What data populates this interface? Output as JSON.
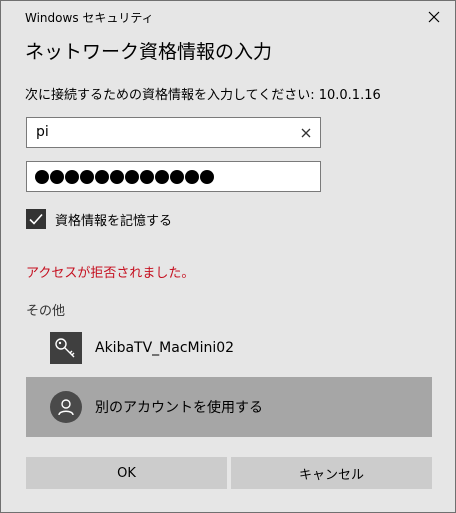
{
  "window": {
    "title": "Windows セキュリティ",
    "close_icon": "close-icon"
  },
  "dialog": {
    "heading": "ネットワーク資格情報の入力",
    "prompt": "次に接続するための資格情報を入力してください: 10.0.1.16"
  },
  "username": {
    "value": "pi",
    "clear_icon": "clear-icon"
  },
  "password": {
    "masked_length": 12
  },
  "remember": {
    "label": "資格情報を記憶する",
    "checked": true
  },
  "error": {
    "message": "アクセスが拒否されました。",
    "color": "#c50f1f"
  },
  "other": {
    "section_label": "その他",
    "saved_account": {
      "label": "AkibaTV_MacMini02",
      "icon": "key-icon"
    },
    "use_other_account": {
      "label": "別のアカウントを使用する",
      "icon": "person-icon"
    }
  },
  "buttons": {
    "ok": "OK",
    "cancel": "キャンセル"
  }
}
